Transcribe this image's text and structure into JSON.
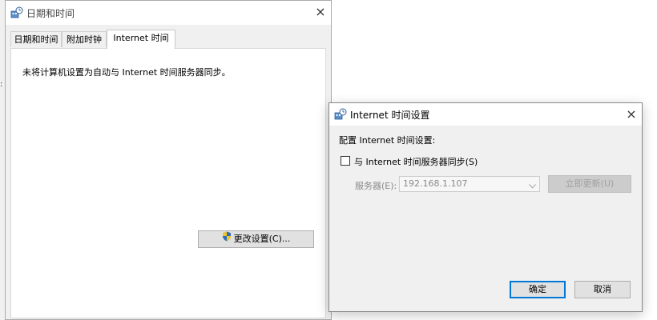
{
  "main_window": {
    "title": "日期和时间",
    "close_glyph": "×",
    "tabs": [
      {
        "label": "日期和时间",
        "active": false
      },
      {
        "label": "附加时钟",
        "active": false
      },
      {
        "label": "Internet 时间",
        "active": true
      }
    ],
    "status_text": "未将计算机设置为自动与 Internet 时间服务器同步。",
    "change_settings_label": "更改设置(C)..."
  },
  "dialog": {
    "title": "Internet 时间设置",
    "close_glyph": "×",
    "config_label": "配置 Internet 时间设置:",
    "sync_checkbox": {
      "label": "与 Internet 时间服务器同步(S)",
      "checked": false
    },
    "server_label": "服务器(E):",
    "server_value": "192.168.1.107",
    "update_now_label": "立即更新(U)",
    "ok_label": "确定",
    "cancel_label": "取消"
  },
  "icons": {
    "window_icon": "clock-globe-icon",
    "shield": "uac-shield-icon"
  },
  "colors": {
    "dialog_bg": "#f0f0f0",
    "primary_border": "#0078d7",
    "disabled_text": "#a0a0a0"
  }
}
